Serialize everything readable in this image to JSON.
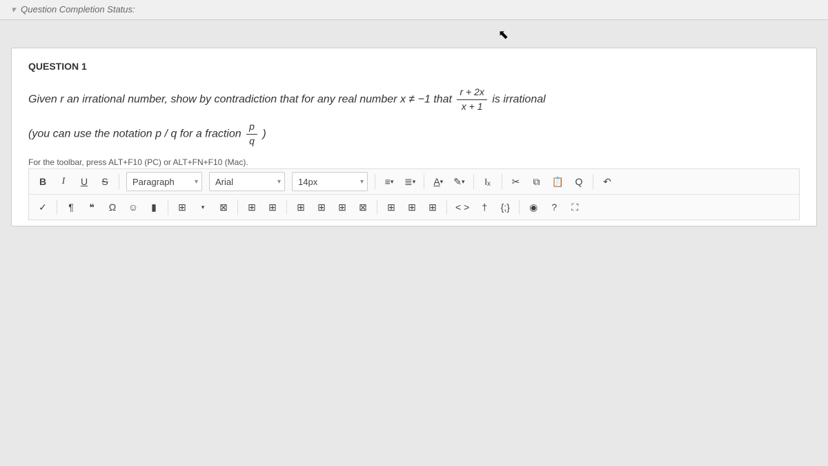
{
  "status_bar": {
    "label": "Question Completion Status:"
  },
  "question": {
    "heading": "QUESTION 1",
    "body_pre": "Given r an irrational number, show by contradiction that for any real number x ",
    "neq_sym": "≠",
    "body_neg1": " −1  that  ",
    "frac1_num": "r + 2x",
    "frac1_den": "x + 1",
    "body_post": "  is irrational",
    "notation_pre": "(you can use the notation p / q for a fraction ",
    "frac2_num": "p",
    "frac2_den": "q",
    "notation_post": " )"
  },
  "toolbar": {
    "hint": "For the toolbar, press ALT+F10 (PC) or ALT+FN+F10 (Mac).",
    "bold": "B",
    "italic": "I",
    "underline": "U",
    "strike": "S",
    "format_select": "Paragraph",
    "font_select": "Arial",
    "size_select": "14px",
    "text_color": "A",
    "clear_fmt": "Iₓ",
    "cut": "✂",
    "copy": "⧉",
    "paste": "📋",
    "find": "Q",
    "undo": "↶",
    "check": "✓",
    "paragraph_mark": "¶",
    "quote": "❝",
    "omega": "Ω",
    "emoji": "☺",
    "bookmark": "▮",
    "table": "⊞",
    "code_view": "< >",
    "nonbreak": "†",
    "braces": "{;}",
    "record": "◉",
    "help": "?",
    "fullscreen": "⛶"
  }
}
